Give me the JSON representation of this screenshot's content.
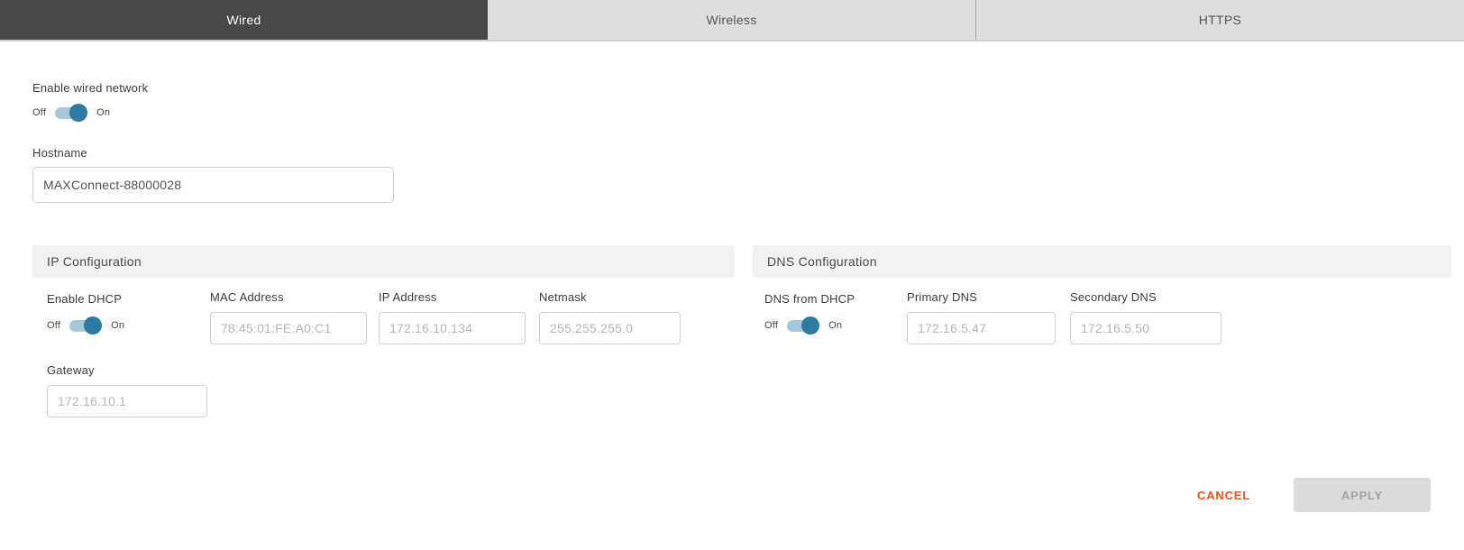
{
  "tabs": [
    {
      "label": "Wired",
      "active": true
    },
    {
      "label": "Wireless",
      "active": false
    },
    {
      "label": "HTTPS",
      "active": false
    }
  ],
  "toggle": {
    "off": "Off",
    "on": "On"
  },
  "general": {
    "enable_wired_label": "Enable wired network",
    "enable_wired_state": "On",
    "hostname_label": "Hostname",
    "hostname_value": "MAXConnect-88000028"
  },
  "ip_configuration": {
    "title": "IP Configuration",
    "enable_dhcp_label": "Enable DHCP",
    "enable_dhcp_state": "On",
    "fields": [
      {
        "label": "MAC Address",
        "value": "78:45:01:FE:A0:C1"
      },
      {
        "label": "IP Address",
        "value": "172.16.10.134"
      },
      {
        "label": "Netmask",
        "value": "255.255.255.0"
      }
    ],
    "gateway": {
      "label": "Gateway",
      "value": "172.16.10.1"
    }
  },
  "dns_configuration": {
    "title": "DNS Configuration",
    "dns_from_dhcp_label": "DNS from DHCP",
    "dns_from_dhcp_state": "On",
    "fields": [
      {
        "label": "Primary DNS",
        "value": "172.16.5.47"
      },
      {
        "label": "Secondary DNS",
        "value": "172.16.5.50"
      }
    ]
  },
  "actions": {
    "cancel": "CANCEL",
    "apply": "APPLY"
  },
  "colors": {
    "active_tab_bg": "#48484a",
    "inactive_tab_bg": "#dedede",
    "toggle_track": "#a9c7db",
    "toggle_knob": "#2d7ba2",
    "cancel_text": "#f4531f",
    "section_header_bg": "#f1f1f2"
  }
}
